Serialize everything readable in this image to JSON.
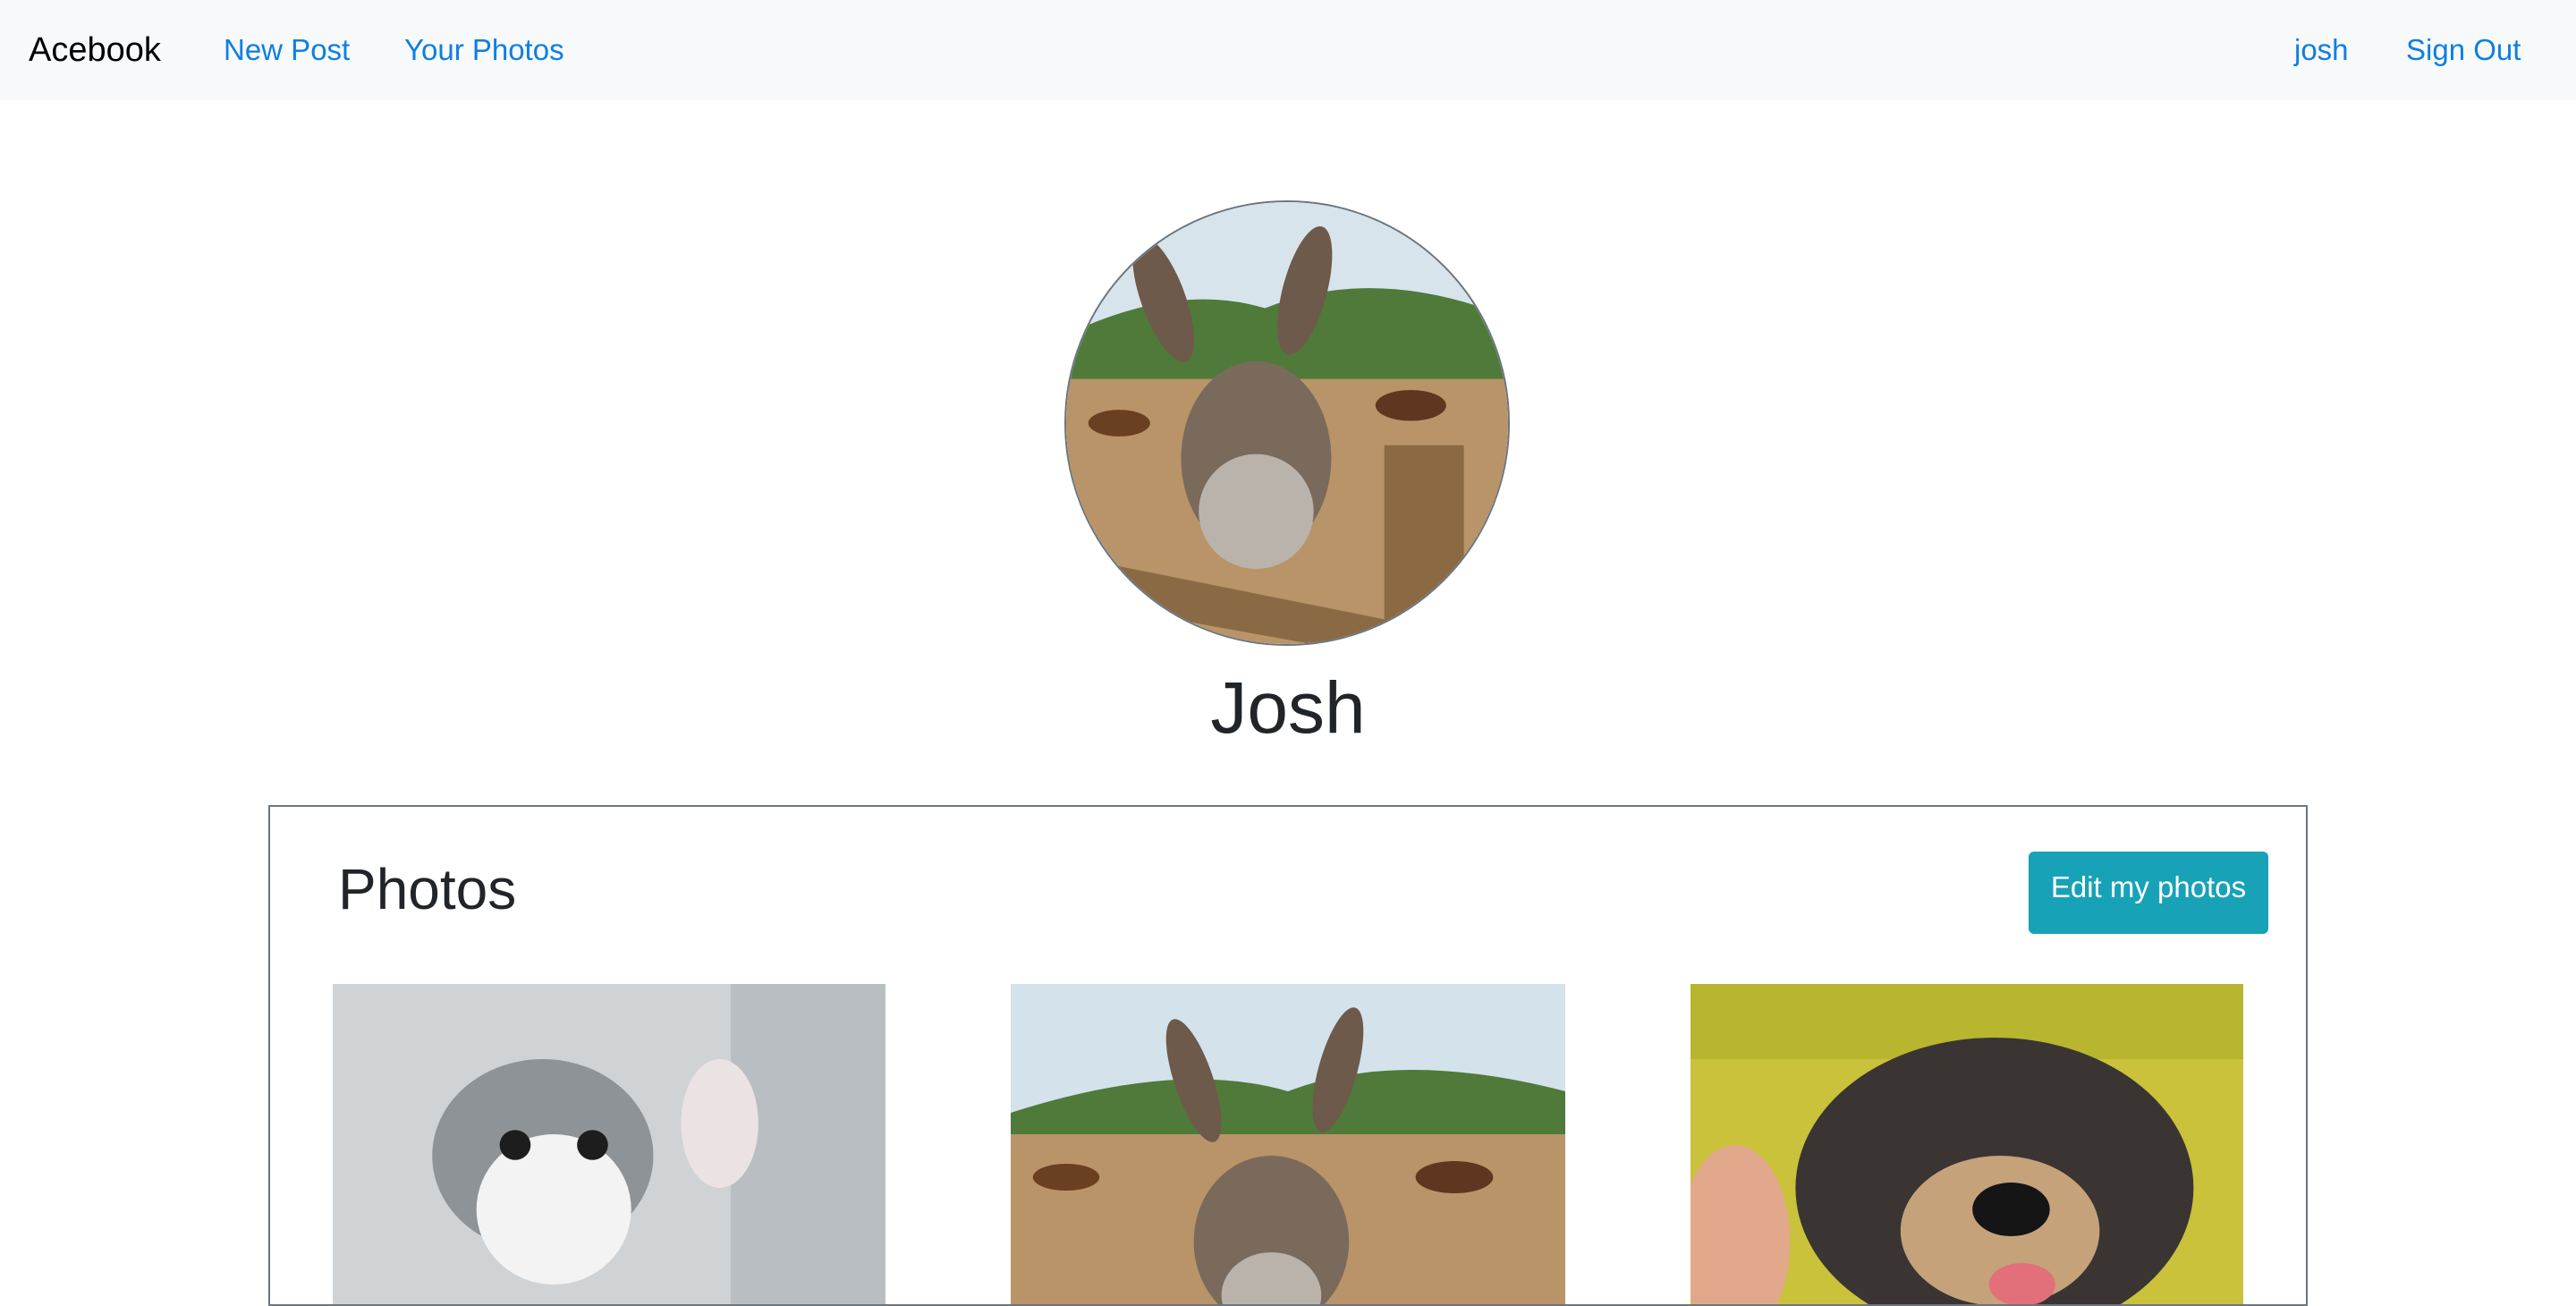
{
  "navbar": {
    "brand": "Acebook",
    "links": [
      "New Post",
      "Your Photos"
    ],
    "right_links": [
      "josh",
      "Sign Out"
    ]
  },
  "profile": {
    "name": "Josh",
    "avatar": "donkey-photo"
  },
  "photos": {
    "title": "Photos",
    "edit_button": "Edit my photos",
    "items": [
      "kitten-photo",
      "donkey-photo",
      "dog-photo"
    ]
  },
  "colors": {
    "link": "#0d7fe3",
    "navbar_bg": "#f8f9fa",
    "button_bg": "#17a2b8"
  }
}
